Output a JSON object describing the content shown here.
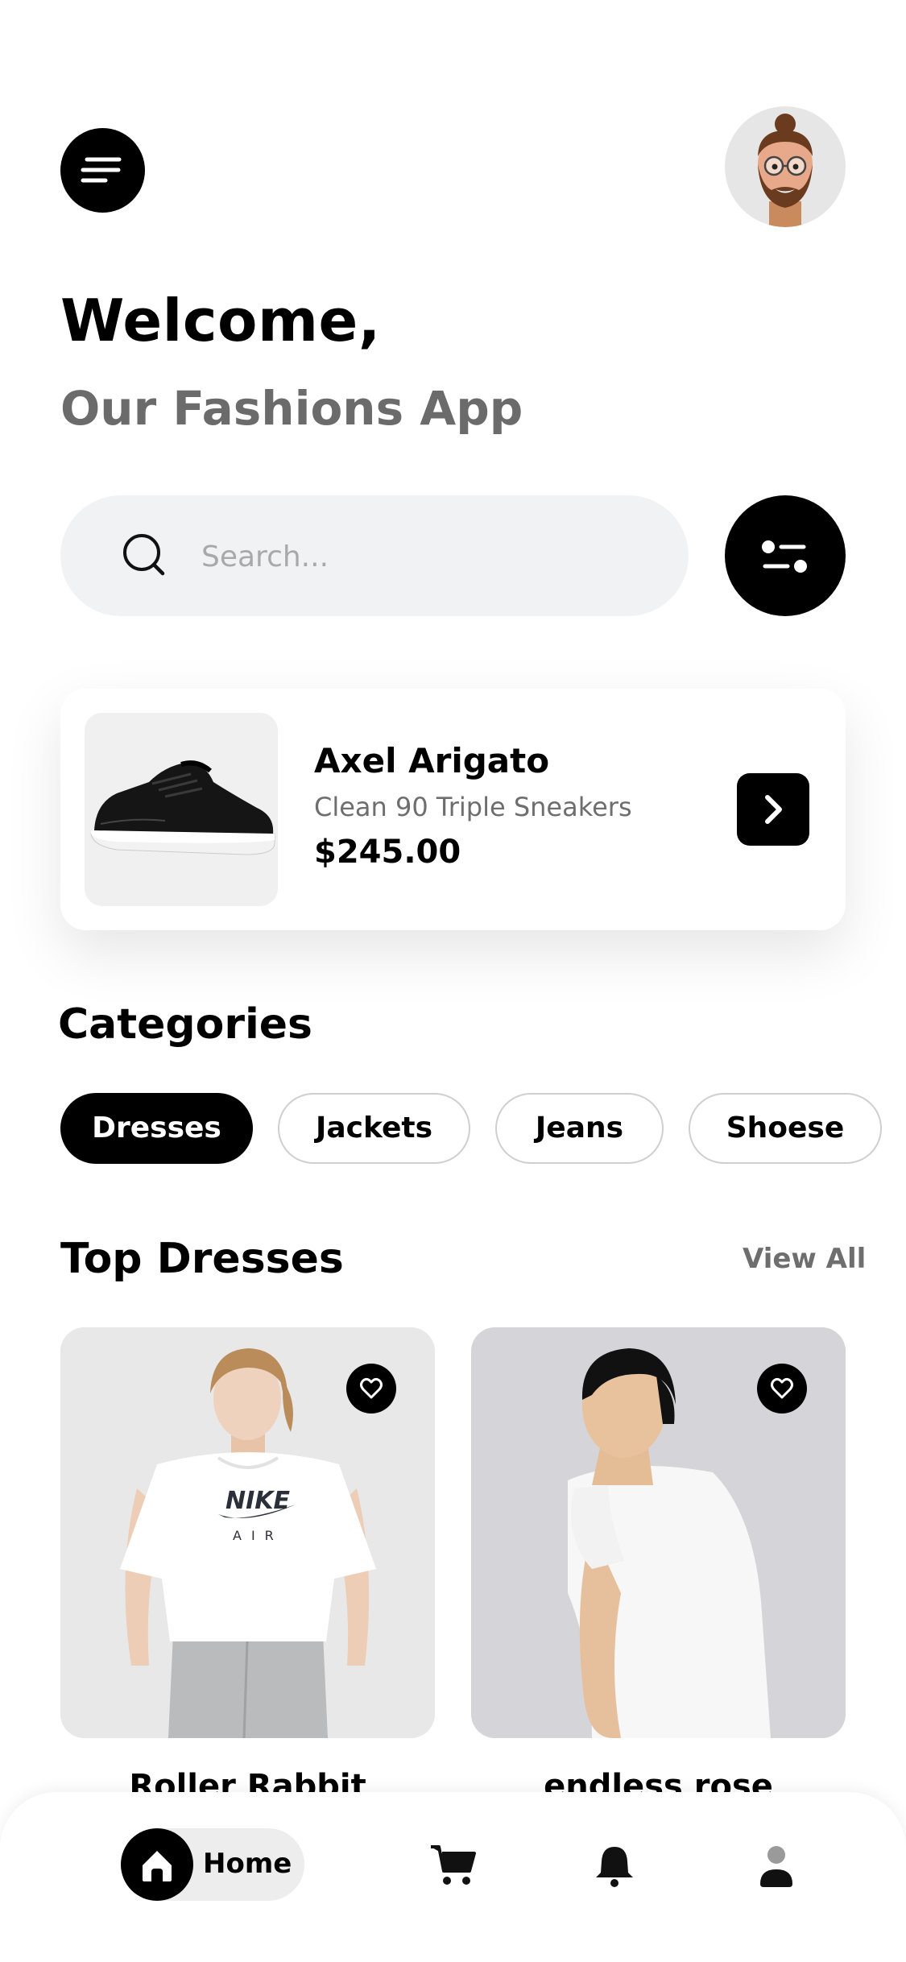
{
  "header": {
    "menu_icon": "menu-icon",
    "avatar_icon": "memoji-avatar"
  },
  "welcome": {
    "title": "Welcome,",
    "subtitle": "Our Fashions App"
  },
  "search": {
    "placeholder": "Search...",
    "value": "",
    "icon": "search-icon",
    "filter_icon": "filter-icon"
  },
  "featured": {
    "brand": "Axel Arigato",
    "name": "Clean 90 Triple Sneakers",
    "price": "$245.00",
    "image": "sneaker-image",
    "arrow_icon": "chevron-right-icon"
  },
  "categories": {
    "title": "Categories",
    "items": [
      {
        "label": "Dresses",
        "active": true
      },
      {
        "label": "Jackets",
        "active": false
      },
      {
        "label": "Jeans",
        "active": false
      },
      {
        "label": "Shoese",
        "active": false
      }
    ]
  },
  "top_dresses": {
    "title": "Top Dresses",
    "view_all": "View All",
    "products": [
      {
        "name": "Roller Rabbit",
        "image": "woman-white-tshirt-photo",
        "fav_icon": "heart-icon"
      },
      {
        "name": "endless rose",
        "image": "man-white-tshirt-photo",
        "fav_icon": "heart-icon"
      }
    ]
  },
  "bottom_nav": {
    "items": [
      {
        "label": "Home",
        "icon": "home-icon",
        "active": true
      },
      {
        "icon": "cart-icon"
      },
      {
        "icon": "bell-icon"
      },
      {
        "icon": "user-icon"
      }
    ]
  },
  "colors": {
    "accent": "#000000",
    "background": "#ffffff",
    "muted_text": "#6b6b6b",
    "search_bg": "#f1f2f4"
  }
}
